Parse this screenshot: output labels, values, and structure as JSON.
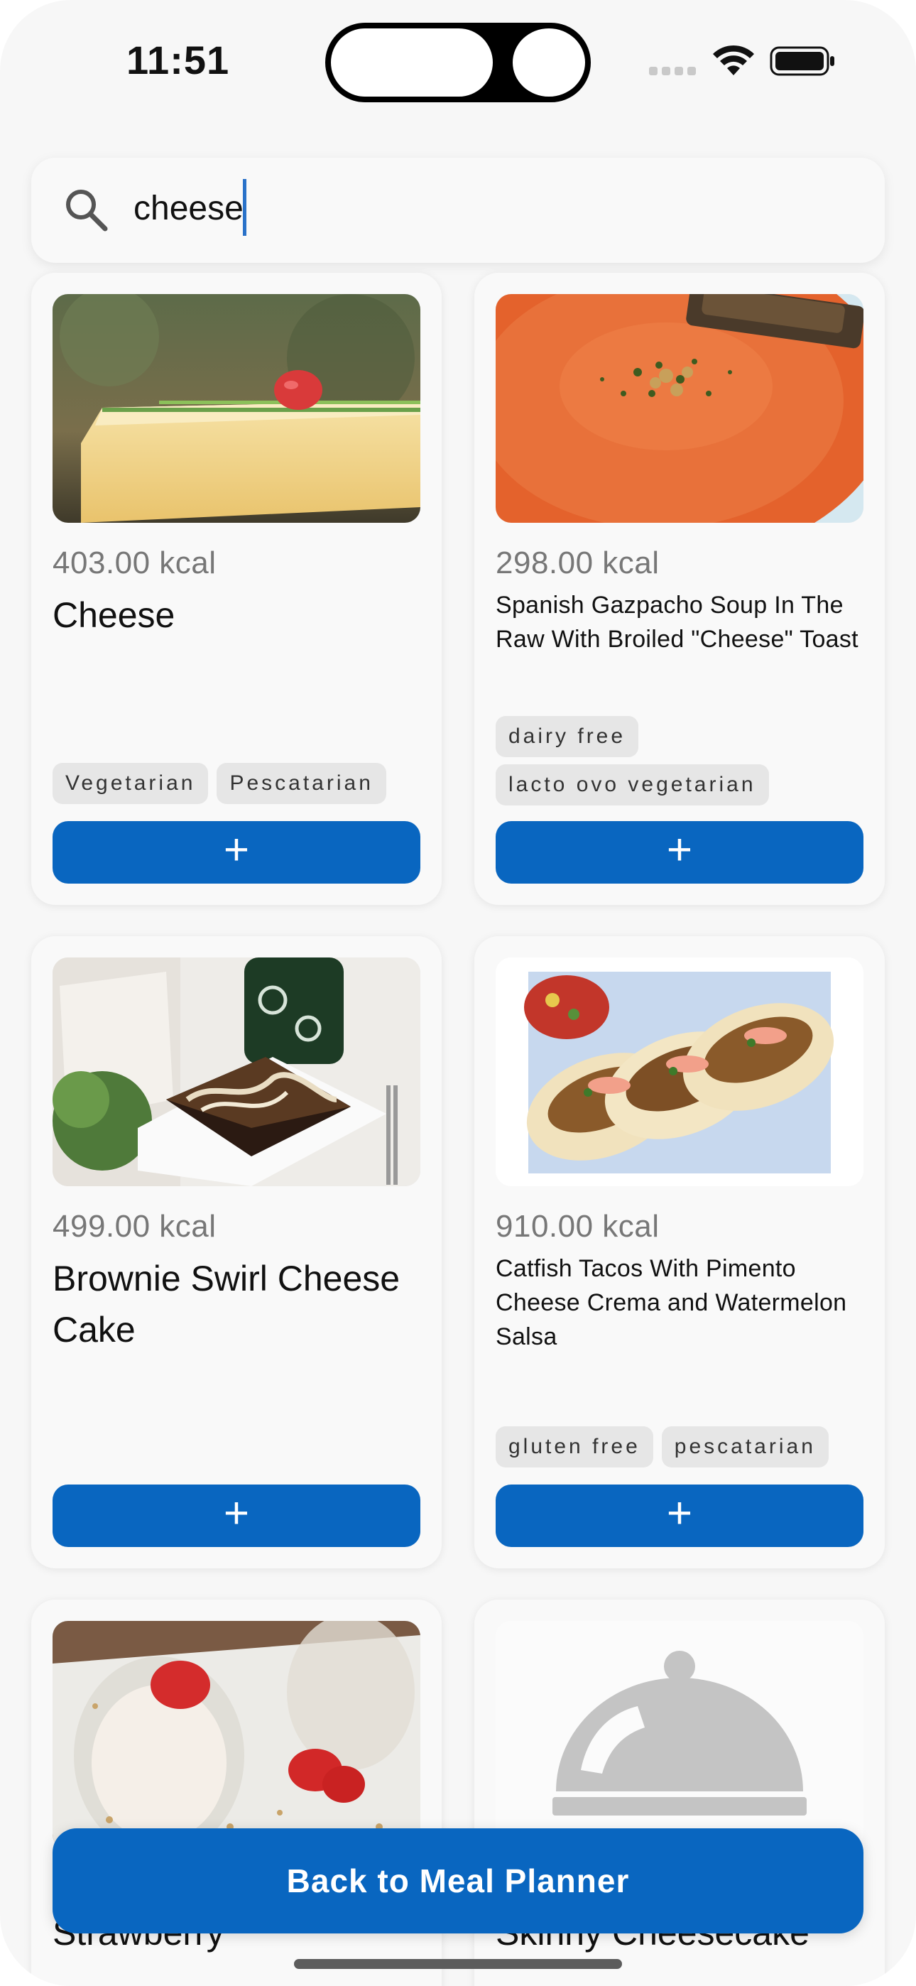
{
  "status_bar": {
    "time": "11:51"
  },
  "search": {
    "value": "cheese"
  },
  "cards": [
    {
      "kcal": "403.00 kcal",
      "title": "Cheese",
      "tags": [
        "Vegetarian",
        "Pescatarian"
      ],
      "add_label": "+"
    },
    {
      "kcal": "298.00 kcal",
      "title": "Spanish Gazpacho Soup In The Raw With Broiled \"Cheese\" Toast",
      "tags": [
        "dairy free",
        "lacto ovo vegetarian"
      ],
      "add_label": "+"
    },
    {
      "kcal": "499.00 kcal",
      "title": "Brownie Swirl Cheese Cake",
      "tags": [],
      "add_label": "+"
    },
    {
      "kcal": "910.00 kcal",
      "title": "Catfish Tacos With Pimento Cheese Crema and Watermelon Salsa",
      "tags": [
        "gluten free",
        "pescatarian"
      ],
      "add_label": "+"
    },
    {
      "title": "Strawberry"
    },
    {
      "title": "Skinny Cheesecake"
    }
  ],
  "footer": {
    "back_label": "Back to Meal Planner"
  },
  "colors": {
    "accent": "#0966c0",
    "background": "#f7f7f7",
    "tag_bg": "#e6e6e6"
  }
}
